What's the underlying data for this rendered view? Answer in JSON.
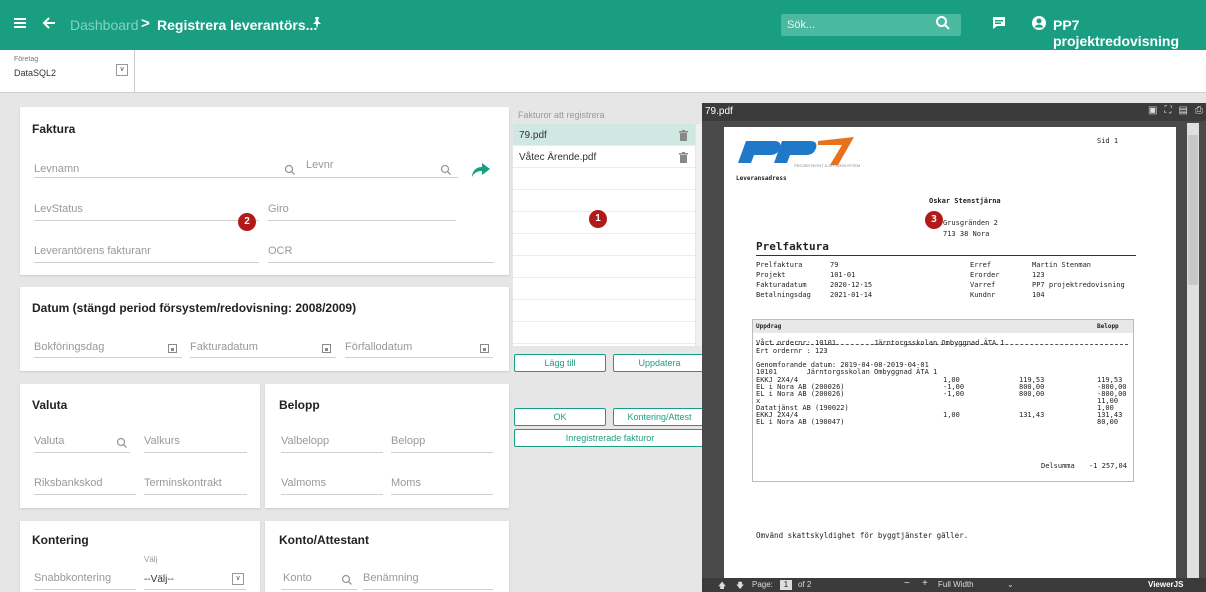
{
  "colors": {
    "accent": "#1a9e82",
    "badge": "#b21a1a"
  },
  "topbar": {
    "menu_icon": "hamburger-icon",
    "back_icon": "arrow-left-icon",
    "breadcrumb_root": "Dashboard",
    "breadcrumb_sep": ">",
    "breadcrumb_current": "Registrera leverantörs...",
    "pin_icon": "pin-icon",
    "search_placeholder": "Sök...",
    "company_name": "PP7 projektredovisning"
  },
  "company_selector": {
    "label": "Företag",
    "value": "DataSQL2"
  },
  "faktura": {
    "title": "Faktura",
    "levnamn": "Levnamn",
    "levnr": "Levnr",
    "levstatus": "LevStatus",
    "giro": "Giro",
    "fakturanr": "Leverantörens fakturanr",
    "ocr": "OCR",
    "badge": "2"
  },
  "datum": {
    "title": "Datum (stängd period försystem/redovisning: 2008/2009)",
    "bokforingsdag": "Bokföringsdag",
    "fakturadatum": "Fakturadatum",
    "forfallodatum": "Förfallodatum"
  },
  "valuta": {
    "title": "Valuta",
    "valuta": "Valuta",
    "valkurs": "Valkurs",
    "riksbankskod": "Riksbankskod",
    "terminskontrakt": "Terminskontrakt"
  },
  "belopp": {
    "title": "Belopp",
    "valbelopp": "Valbelopp",
    "belopp": "Belopp",
    "valmoms": "Valmoms",
    "moms": "Moms"
  },
  "kontering": {
    "title": "Kontering",
    "snabbkontering": "Snabbkontering",
    "valj_label": "Välj",
    "valj_value": "--Välj--"
  },
  "konto_attestant": {
    "title": "Konto/Attestant",
    "konto": "Konto",
    "benamning": "Benämning"
  },
  "invoice_list": {
    "title": "Fakturor att registrera",
    "items": [
      {
        "name": "79.pdf"
      },
      {
        "name": "Våtec Ärende.pdf"
      }
    ],
    "badge": "1"
  },
  "buttons": {
    "lagg_till": "Lägg till",
    "uppdatera": "Uppdatera",
    "ok": "OK",
    "kontering_attest": "Kontering/Attest",
    "inregistrerade": "Inregistrerade fakturor"
  },
  "pdf": {
    "filename": "79.pdf",
    "page_label": "Page:",
    "page_current": "1",
    "page_total": "of 2",
    "zoom": "Full Width",
    "brand": "ViewerJS",
    "content": {
      "sid": "Sid 1",
      "logo_text": "PP7",
      "logo_sub": "PROJEKTKONT & AFFÄRSSYSTEM",
      "leveransadress": "Leveransadress",
      "recipient": "Oskar Stenstjärna",
      "address1": "Grusgränden 2",
      "address2": "713 38 Nora",
      "badge": "3",
      "heading": "Prelfaktura",
      "left_labels": [
        "Prelfaktura",
        "Projekt",
        "Fakturadatum",
        "Betalningsdag"
      ],
      "left_values": [
        "79",
        "101-01",
        "2020-12-15",
        "2021-01-14"
      ],
      "right_labels": [
        "Erref",
        "Erorder",
        "Varref",
        "Kundnr"
      ],
      "right_values": [
        "Martin Stenman",
        "123",
        "PP7 projektredovisning",
        "104"
      ],
      "table_header_left": "Uppdrag",
      "table_header_right": "Belopp",
      "line1": "Vårt ordernr: 10101         Järntorgsskolan Ombyggnad ÄTA 1",
      "line2": "Ert ordernr : 123",
      "line3": "Genomforande datum: 2019-04-08-2019-04-01",
      "line4": "10101       Järntorgsskolan Ombyggnad ÄTA 1",
      "rows": [
        {
          "desc": "EKKJ 2X4/4",
          "qty": "1,00",
          "price": "119,53",
          "sum": "119,53"
        },
        {
          "desc": "EL i Nora AB (200026)",
          "qty": "-1,00",
          "price": "800,00",
          "sum": "-800,00"
        },
        {
          "desc": "EL i Nora AB (200026)",
          "qty": "-1,00",
          "price": "800,00",
          "sum": "-800,00"
        },
        {
          "desc": "x",
          "qty": "",
          "price": "",
          "sum": "11,00"
        },
        {
          "desc": "Datatjänst AB (190022)",
          "qty": "",
          "price": "",
          "sum": "1,00"
        },
        {
          "desc": "EKKJ 2X4/4",
          "qty": "1,00",
          "price": "131,43",
          "sum": "131,43"
        },
        {
          "desc": "EL i Nora AB (190047)",
          "qty": "",
          "price": "",
          "sum": "80,00"
        }
      ],
      "delsumma_label": "Delsumma",
      "delsumma_value": "-1 257,04",
      "footer_note": "Omvänd skattskyldighet för byggtjänster gäller."
    }
  }
}
